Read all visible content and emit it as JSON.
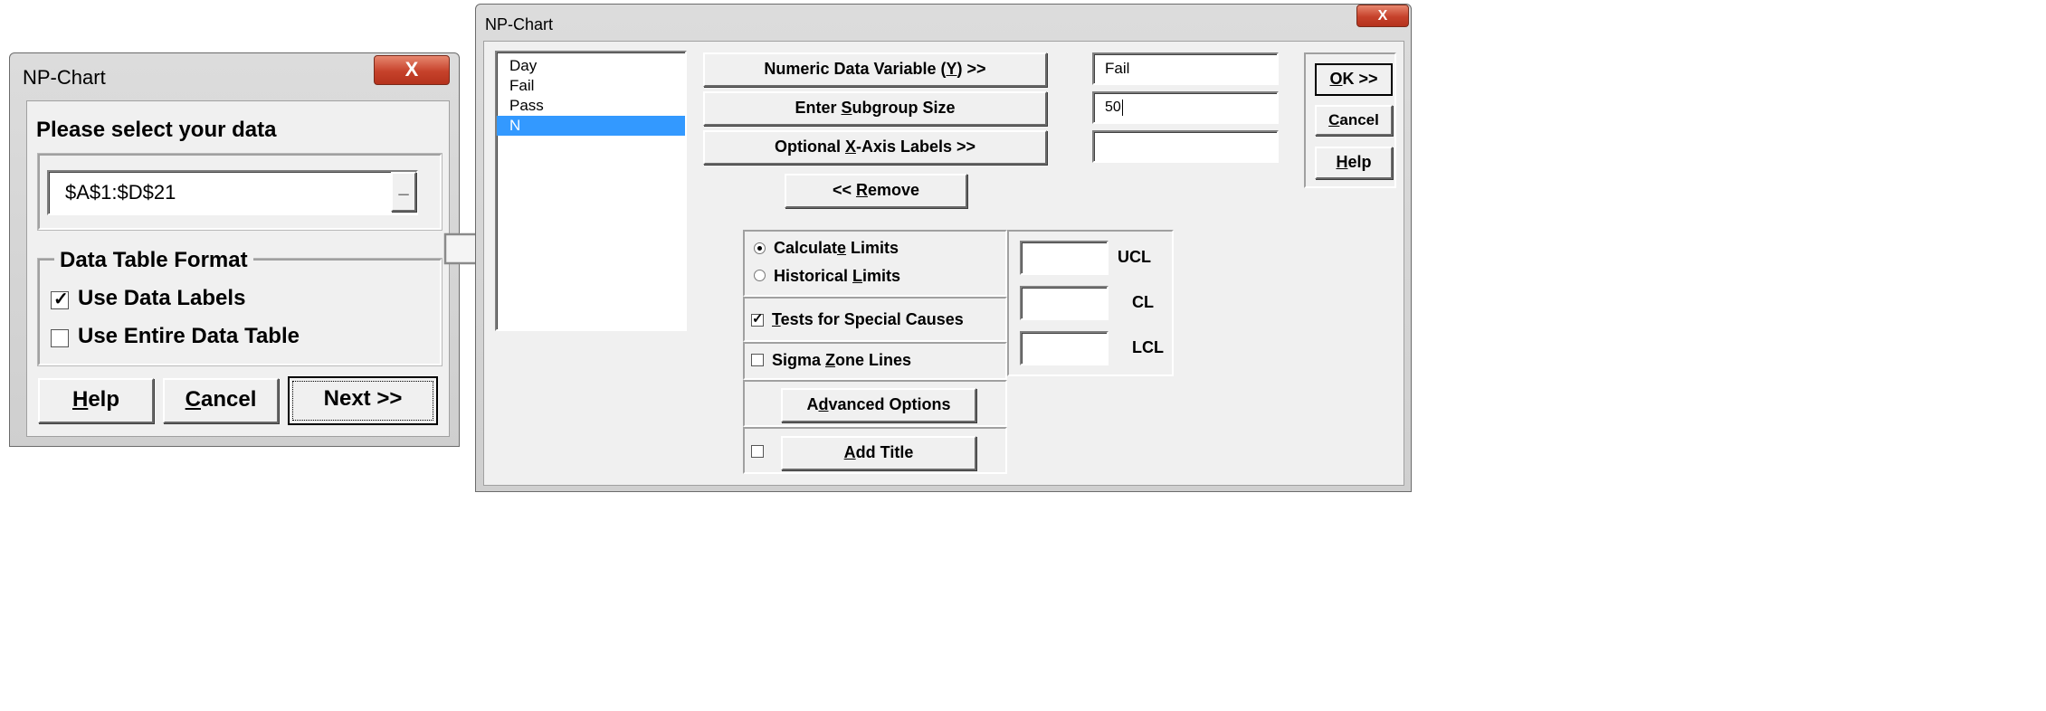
{
  "left_dialog": {
    "title": "NP-Chart",
    "close_glyph": "X",
    "prompt": "Please select your data",
    "range_value": "$A$1:$D$21",
    "range_button_glyph": "_",
    "format_group_label": "Data Table Format",
    "use_data_labels": {
      "label": "Use Data Labels",
      "checked": true
    },
    "use_entire_table": {
      "label": "Use Entire Data Table",
      "checked": false
    },
    "buttons": {
      "help": {
        "pre": "",
        "key": "H",
        "post": "elp"
      },
      "cancel": {
        "pre": "",
        "key": "C",
        "post": "ancel"
      },
      "next": {
        "label": "Next >>"
      }
    }
  },
  "right_dialog": {
    "title": "NP-Chart",
    "close_glyph": "X",
    "variables": [
      "Day",
      "Fail",
      "Pass",
      "N"
    ],
    "selected_variable": "N",
    "numeric_data_button": {
      "pre": "Numeric Data Variable (",
      "key": "Y",
      "post": ") >>"
    },
    "subgroup_button": {
      "pre": "Enter ",
      "key": "S",
      "post": "ubgroup Size"
    },
    "xaxis_button": {
      "pre": "Optional ",
      "key": "X",
      "post": "-Axis Labels >>"
    },
    "remove_button": {
      "pre": "<< ",
      "key": "R",
      "post": "emove"
    },
    "numeric_data_value": "Fail",
    "subgroup_value": "50",
    "xaxis_value": "",
    "ok_button": {
      "pre": "",
      "key": "O",
      "post": "K >>"
    },
    "cancel_button": {
      "pre": "",
      "key": "C",
      "post": "ancel"
    },
    "help_button": {
      "pre": "",
      "key": "H",
      "post": "elp"
    },
    "calculate_limits": {
      "pre": "Calculat",
      "key": "e",
      "post": " Limits",
      "selected": true
    },
    "historical_limits": {
      "pre": "Historical ",
      "key": "L",
      "post": "imits",
      "selected": false
    },
    "tests_special": {
      "pre": "",
      "key": "T",
      "post": "ests for Special Causes",
      "checked": true
    },
    "sigma_zone": {
      "pre": "Sigma ",
      "key": "Z",
      "post": "one Lines",
      "checked": false
    },
    "advanced_button": {
      "pre": "A",
      "key": "d",
      "post": "vanced Options"
    },
    "add_title": {
      "pre": "",
      "key": "A",
      "post": "dd Title",
      "checked": false
    },
    "ucl": {
      "label": "UCL",
      "value": ""
    },
    "cl": {
      "label": "CL",
      "value": ""
    },
    "lcl": {
      "label": "LCL",
      "value": ""
    }
  },
  "colors": {
    "dialog_bg": "#f0f0f0",
    "selection": "#3399ff",
    "close_red": "#c6422b"
  }
}
